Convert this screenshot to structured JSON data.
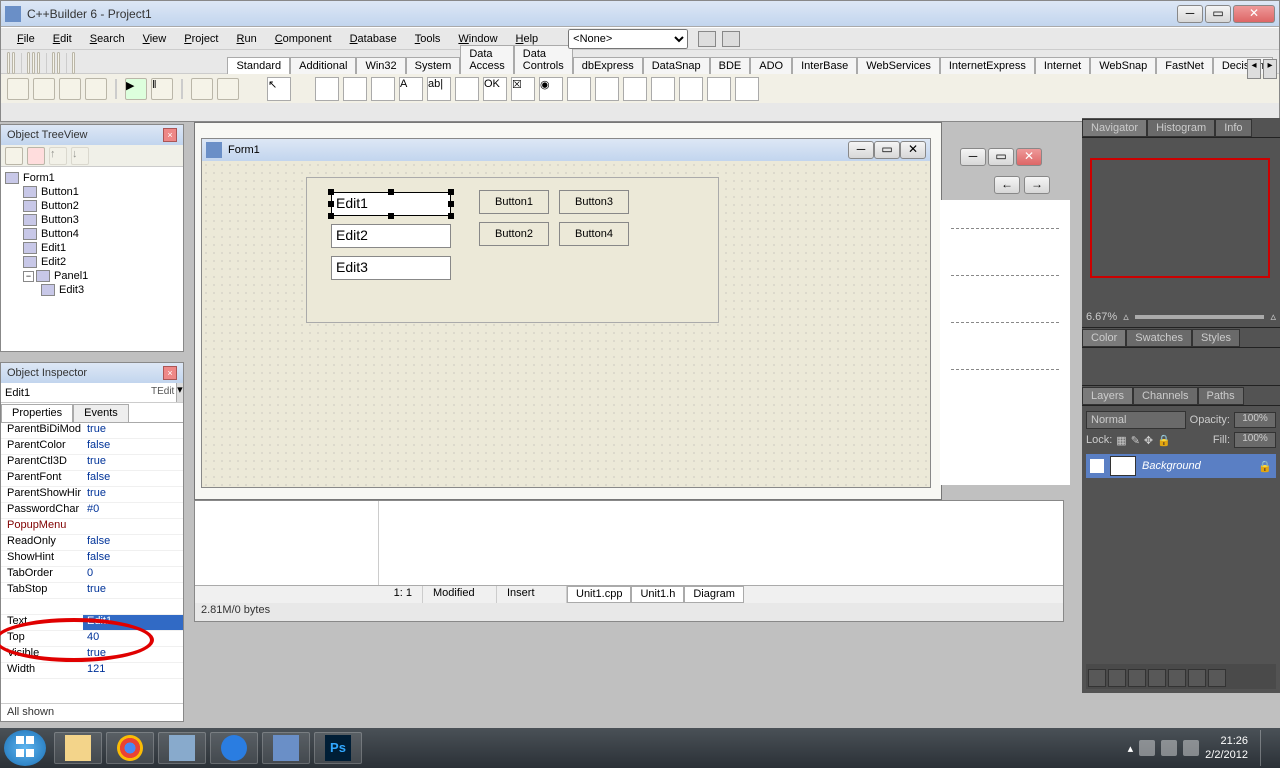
{
  "app": {
    "title": "C++Builder 6 - Project1"
  },
  "menu": {
    "items": [
      "File",
      "Edit",
      "Search",
      "View",
      "Project",
      "Run",
      "Component",
      "Database",
      "Tools",
      "Window",
      "Help"
    ],
    "combo": "<None>"
  },
  "palette_tabs": [
    "Standard",
    "Additional",
    "Win32",
    "System",
    "Data Access",
    "Data Controls",
    "dbExpress",
    "DataSnap",
    "BDE",
    "ADO",
    "InterBase",
    "WebServices",
    "InternetExpress",
    "Internet",
    "WebSnap",
    "FastNet",
    "Decision"
  ],
  "treeview": {
    "title": "Object TreeView",
    "root": "Form1",
    "items": [
      "Button1",
      "Button2",
      "Button3",
      "Button4",
      "Edit1",
      "Edit2",
      "Panel1"
    ],
    "sub": "Edit3"
  },
  "inspector": {
    "title": "Object Inspector",
    "component": "Edit1",
    "type": "TEdit",
    "tabs": [
      "Properties",
      "Events"
    ],
    "props": [
      {
        "k": "ParentBiDiMod",
        "v": "true"
      },
      {
        "k": "ParentColor",
        "v": "false"
      },
      {
        "k": "ParentCtl3D",
        "v": "true"
      },
      {
        "k": "ParentFont",
        "v": "false"
      },
      {
        "k": "ParentShowHir",
        "v": "true"
      },
      {
        "k": "PasswordChar",
        "v": "#0"
      },
      {
        "k": "PopupMenu",
        "v": "",
        "red": true
      },
      {
        "k": "ReadOnly",
        "v": "false"
      },
      {
        "k": "ShowHint",
        "v": "false"
      },
      {
        "k": "TabOrder",
        "v": "0"
      },
      {
        "k": "TabStop",
        "v": "true"
      },
      {
        "k": "",
        "v": ""
      },
      {
        "k": "Text",
        "v": "Edit1",
        "sel": true
      },
      {
        "k": "Top",
        "v": "40"
      },
      {
        "k": "Visible",
        "v": "true"
      },
      {
        "k": "Width",
        "v": "121"
      }
    ],
    "footer": "All shown"
  },
  "form": {
    "title": "Form1",
    "edits": [
      "Edit1",
      "Edit2",
      "Edit3"
    ],
    "buttons": [
      "Button1",
      "Button2",
      "Button3",
      "Button4"
    ]
  },
  "editor": {
    "pos": "1: 1",
    "modified": "Modified",
    "mode": "Insert",
    "tabs": [
      "Unit1.cpp",
      "Unit1.h",
      "Diagram"
    ],
    "footer": "2.81M/0 bytes"
  },
  "ps": {
    "nav_tabs": [
      "Navigator",
      "Histogram",
      "Info"
    ],
    "zoom": "6.67%",
    "col_tabs": [
      "Color",
      "Swatches",
      "Styles"
    ],
    "layer_tabs": [
      "Layers",
      "Channels",
      "Paths"
    ],
    "mode": "Normal",
    "opacity_lbl": "Opacity:",
    "opacity": "100%",
    "lock_lbl": "Lock:",
    "fill_lbl": "Fill:",
    "fill": "100%",
    "layer_name": "Background"
  },
  "taskbar": {
    "time": "21:26",
    "date": "2/2/2012"
  }
}
